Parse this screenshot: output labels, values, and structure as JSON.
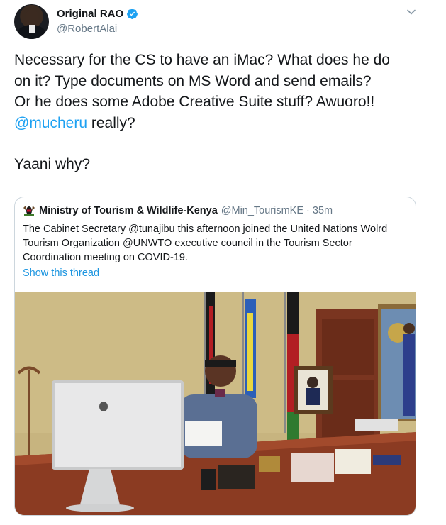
{
  "tweet": {
    "author": {
      "display_name": "Original RAO",
      "handle": "@RobertAlai"
    },
    "text": {
      "line1": "Necessary for the CS to have an iMac? What does he do",
      "line2": "on it? Type documents on MS Word and send emails?",
      "line3": "Or he does some Adobe Creative Suite stuff? Awuoro!!",
      "mention": "@mucheru",
      "mention_suffix": " really?",
      "line5": "Yaani why?"
    },
    "quoted": {
      "display_name": "Ministry of Tourism & Wildlife-Kenya",
      "meta": "@Min_TourismKE · 35m",
      "text": "The Cabinet Secretary @tunajibu this afternoon joined the United Nations Wolrd Tourism Organization @UNWTO executive council in the Tourism Sector Coordination meeting on COVID-19.",
      "show_thread": "Show this thread"
    }
  },
  "icons": {
    "verified": "verified-badge-icon",
    "caret": "chevron-down-icon",
    "ministry_logo": "coat-of-arms-icon"
  },
  "colors": {
    "text": "#14171a",
    "secondary": "#657786",
    "link": "#1da1f2",
    "border": "#ccd6dd"
  }
}
